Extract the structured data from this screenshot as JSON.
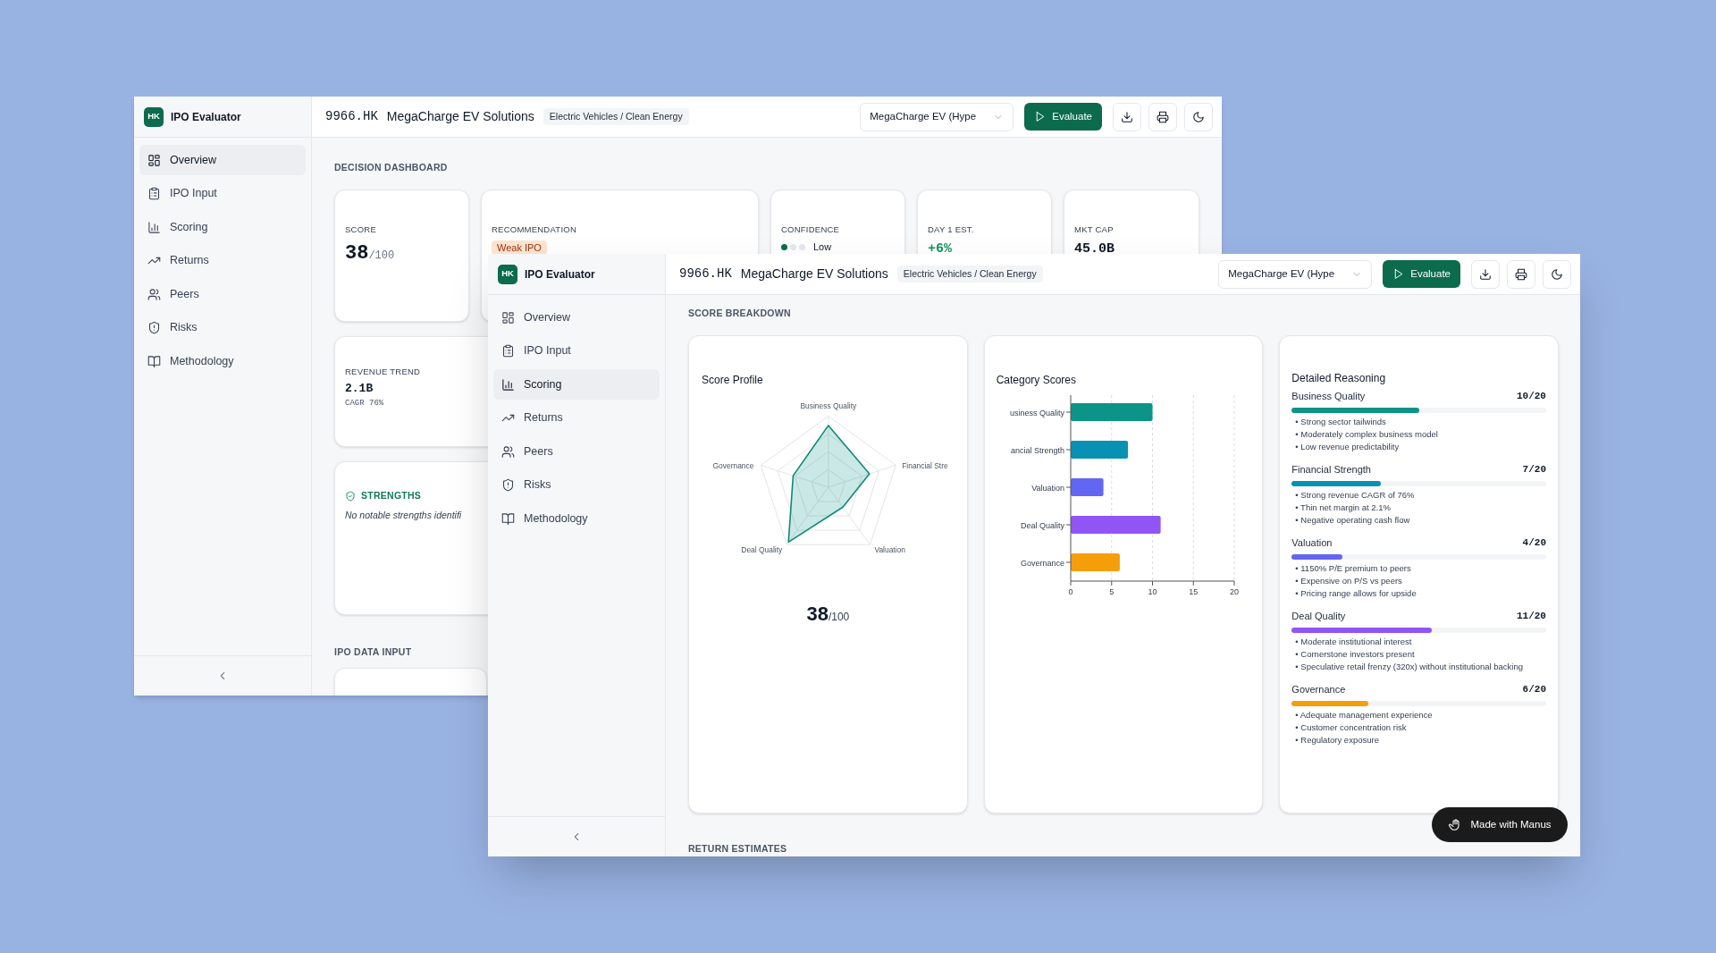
{
  "windows": [
    {
      "kind": "dashboard",
      "brand": {
        "logo": "HK",
        "name": "IPO Evaluator"
      },
      "nav": [
        {
          "label": "Overview",
          "selected": true
        },
        {
          "label": "IPO Input",
          "selected": false
        },
        {
          "label": "Scoring",
          "selected": false
        },
        {
          "label": "Returns",
          "selected": false
        },
        {
          "label": "Peers",
          "selected": false
        },
        {
          "label": "Risks",
          "selected": false
        },
        {
          "label": "Methodology",
          "selected": false
        }
      ],
      "header": {
        "ticker": "9966.HK",
        "company": "MegaCharge EV Solutions",
        "sector": "Electric Vehicles / Clean Energy",
        "selector": "MegaCharge EV (Hype",
        "evaluate": "Evaluate"
      },
      "dashboard": {
        "heading": "DECISION DASHBOARD",
        "metrics": [
          {
            "kind": "score",
            "label": "SCORE",
            "value": "38",
            "suffix": "/100"
          },
          {
            "kind": "badge",
            "label": "RECOMMENDATION",
            "value": "Weak IPO"
          },
          {
            "kind": "dots",
            "label": "CONFIDENCE",
            "dots": [
              {
                "on": true
              },
              {
                "on": false
              },
              {
                "on": false
              }
            ],
            "value": "Low"
          },
          {
            "kind": "change",
            "label": "DAY 1 EST.",
            "value": "+6%"
          },
          {
            "kind": "plain",
            "label": "MKT CAP",
            "value": "45.0B"
          }
        ],
        "revenue": {
          "label": "REVENUE TREND",
          "value": "2.1B",
          "note": "CAGR 76%"
        },
        "strengths": {
          "title": "STRENGTHS",
          "text": "No notable strengths identifi"
        },
        "next_heading": "IPO DATA INPUT"
      }
    },
    {
      "kind": "scoring",
      "brand": {
        "logo": "HK",
        "name": "IPO Evaluator"
      },
      "nav": [
        {
          "label": "Overview",
          "selected": false
        },
        {
          "label": "IPO Input",
          "selected": false
        },
        {
          "label": "Scoring",
          "selected": true
        },
        {
          "label": "Returns",
          "selected": false
        },
        {
          "label": "Peers",
          "selected": false
        },
        {
          "label": "Risks",
          "selected": false
        },
        {
          "label": "Methodology",
          "selected": false
        }
      ],
      "header": {
        "ticker": "9966.HK",
        "company": "MegaCharge EV Solutions",
        "sector": "Electric Vehicles / Clean Energy",
        "selector": "MegaCharge EV (Hype",
        "evaluate": "Evaluate"
      },
      "breakdown": {
        "heading": "SCORE BREAKDOWN",
        "profile": {
          "title": "Score Profile",
          "axes": [
            "Business Quality",
            "Financial Stre",
            "Valuation",
            "Deal Quality",
            "Governance"
          ],
          "score": "38",
          "suffix": "/100"
        },
        "categories": {
          "chart_data": {
            "type": "bar",
            "orientation": "horizontal",
            "title": "Category Scores",
            "categories": [
              "usiness Quality",
              "ancial Strength",
              "Valuation",
              "Deal Quality",
              "Governance"
            ],
            "series": [
              {
                "values": [
                  10,
                  7,
                  4,
                  11,
                  6
                ]
              }
            ],
            "xlim": [
              0,
              20
            ],
            "xticks": [
              0,
              5,
              10,
              15,
              20
            ],
            "grid": true
          }
        },
        "reasoning": {
          "title": "Detailed Reasoning",
          "items": [
            {
              "name": "Business Quality",
              "score": "10/20",
              "level": 0.5,
              "color": "#0d9488",
              "bullets": [
                "• Strong sector tailwinds",
                "• Moderately complex business model",
                "• Low revenue predictability"
              ]
            },
            {
              "name": "Financial Strength",
              "score": "7/20",
              "level": 0.35,
              "color": "#0891b2",
              "bullets": [
                "• Strong revenue CAGR of 76%",
                "• Thin net margin at 2.1%",
                "• Negative operating cash flow"
              ]
            },
            {
              "name": "Valuation",
              "score": "4/20",
              "level": 0.2,
              "color": "#6366f1",
              "bullets": [
                "• 1150% P/E premium to peers",
                "• Expensive on P/S vs peers",
                "• Pricing range allows for upside"
              ]
            },
            {
              "name": "Deal Quality",
              "score": "11/20",
              "level": 0.55,
              "color": "#9155f5",
              "bullets": [
                "• Moderate institutional interest",
                "• Cornerstone investors present",
                "• Speculative retail frenzy (320x) without institutional backing"
              ]
            },
            {
              "name": "Governance",
              "score": "6/20",
              "level": 0.3,
              "color": "#f59e0b",
              "bullets": [
                "• Adequate management experience",
                "• Customer concentration risk",
                "• Regulatory exposure"
              ]
            }
          ]
        },
        "next_heading": "RETURN ESTIMATES"
      },
      "badge": {
        "label": "Made with Manus"
      }
    }
  ]
}
